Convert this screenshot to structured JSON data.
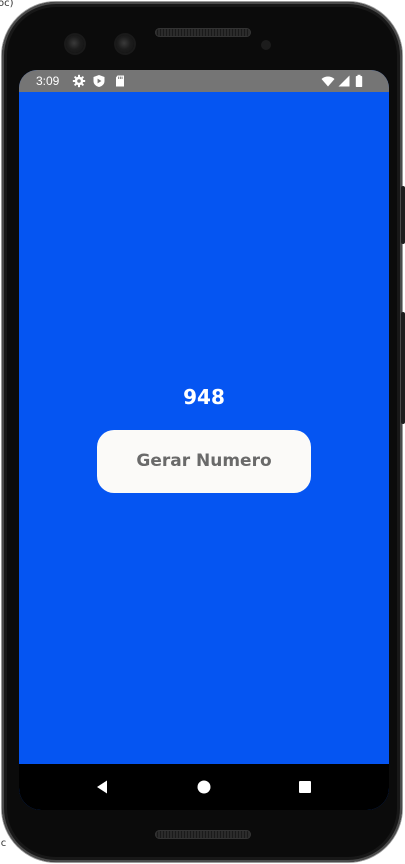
{
  "app": {
    "number": "948",
    "button_label": "Gerar Numero",
    "background_color": "#0555f2",
    "button_color": "#fbfaf8",
    "button_text_color": "#6a6a6a"
  },
  "status_bar": {
    "time": "3:09",
    "left_icons": [
      "settings-icon",
      "shield-play-icon",
      "sd-card-icon"
    ],
    "right_icons": [
      "wifi-icon",
      "signal-icon",
      "battery-icon"
    ],
    "background_color": "#757575"
  },
  "nav_bar": {
    "buttons": [
      "back-icon",
      "home-icon",
      "recents-icon"
    ]
  },
  "backdrop": {
    "top_fragment": "oc)",
    "left_fragment": "ic"
  }
}
